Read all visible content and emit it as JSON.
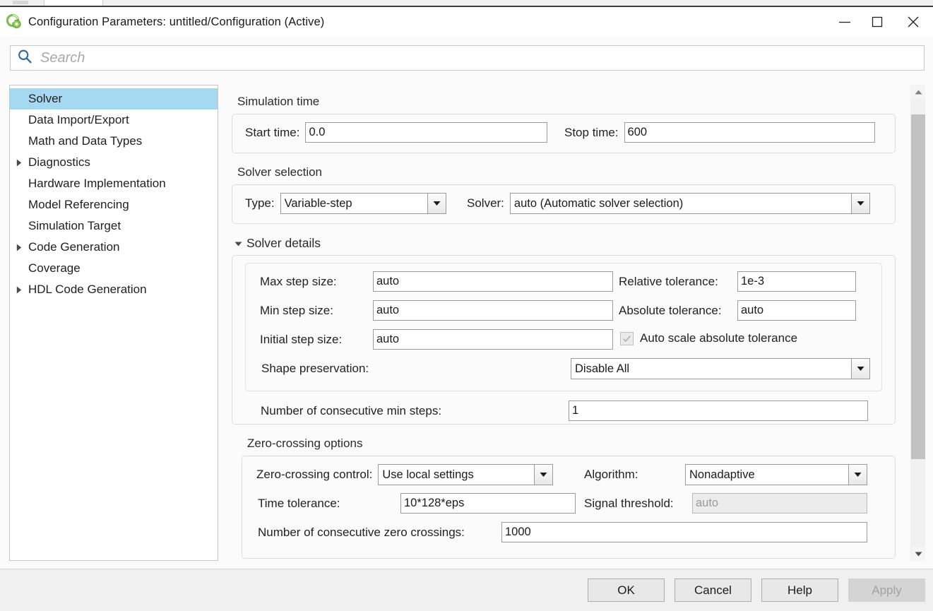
{
  "window": {
    "title": "Configuration Parameters: untitled/Configuration (Active)",
    "app_icon": "simulink-icon",
    "minimize_label": "Minimize",
    "maximize_label": "Maximize",
    "close_label": "Close"
  },
  "search": {
    "placeholder": "Search",
    "value": "",
    "icon": "search-icon"
  },
  "sidebar": {
    "items": [
      {
        "label": "Solver",
        "expandable": false,
        "selected": true
      },
      {
        "label": "Data Import/Export",
        "expandable": false,
        "selected": false
      },
      {
        "label": "Math and Data Types",
        "expandable": false,
        "selected": false
      },
      {
        "label": "Diagnostics",
        "expandable": true,
        "selected": false
      },
      {
        "label": "Hardware Implementation",
        "expandable": false,
        "selected": false
      },
      {
        "label": "Model Referencing",
        "expandable": false,
        "selected": false
      },
      {
        "label": "Simulation Target",
        "expandable": false,
        "selected": false
      },
      {
        "label": "Code Generation",
        "expandable": true,
        "selected": false
      },
      {
        "label": "Coverage",
        "expandable": false,
        "selected": false
      },
      {
        "label": "HDL Code Generation",
        "expandable": true,
        "selected": false
      }
    ]
  },
  "main": {
    "simulation_time": {
      "title": "Simulation time",
      "start_time_label": "Start time:",
      "start_time_value": "0.0",
      "stop_time_label": "Stop time:",
      "stop_time_value": "600"
    },
    "solver_selection": {
      "title": "Solver selection",
      "type_label": "Type:",
      "type_value": "Variable-step",
      "solver_label": "Solver:",
      "solver_value": "auto (Automatic solver selection)"
    },
    "solver_details": {
      "title": "Solver details",
      "expanded": true,
      "max_step_label": "Max step size:",
      "max_step_value": "auto",
      "min_step_label": "Min step size:",
      "min_step_value": "auto",
      "initial_step_label": "Initial step size:",
      "initial_step_value": "auto",
      "relative_tol_label": "Relative tolerance:",
      "relative_tol_value": "1e-3",
      "absolute_tol_label": "Absolute tolerance:",
      "absolute_tol_value": "auto",
      "auto_scale_label": "Auto scale absolute tolerance",
      "auto_scale_checked": true,
      "auto_scale_enabled": false,
      "shape_preservation_label": "Shape preservation:",
      "shape_preservation_value": "Disable All",
      "consecutive_min_steps_label": "Number of consecutive min steps:",
      "consecutive_min_steps_value": "1"
    },
    "zero_crossing": {
      "title": "Zero-crossing options",
      "control_label": "Zero-crossing control:",
      "control_value": "Use local settings",
      "algorithm_label": "Algorithm:",
      "algorithm_value": "Nonadaptive",
      "time_tolerance_label": "Time tolerance:",
      "time_tolerance_value": "10*128*eps",
      "signal_threshold_label": "Signal threshold:",
      "signal_threshold_value": "auto",
      "signal_threshold_enabled": false,
      "consecutive_zc_label": "Number of consecutive zero crossings:",
      "consecutive_zc_value": "1000"
    }
  },
  "footer": {
    "ok_label": "OK",
    "cancel_label": "Cancel",
    "help_label": "Help",
    "apply_label": "Apply",
    "apply_enabled": false
  },
  "colors": {
    "selection": "#a6d8f2",
    "accent_icon_green": "#6cbb3c",
    "panel_border": "#dedede",
    "field_border": "#9b9b9b"
  }
}
